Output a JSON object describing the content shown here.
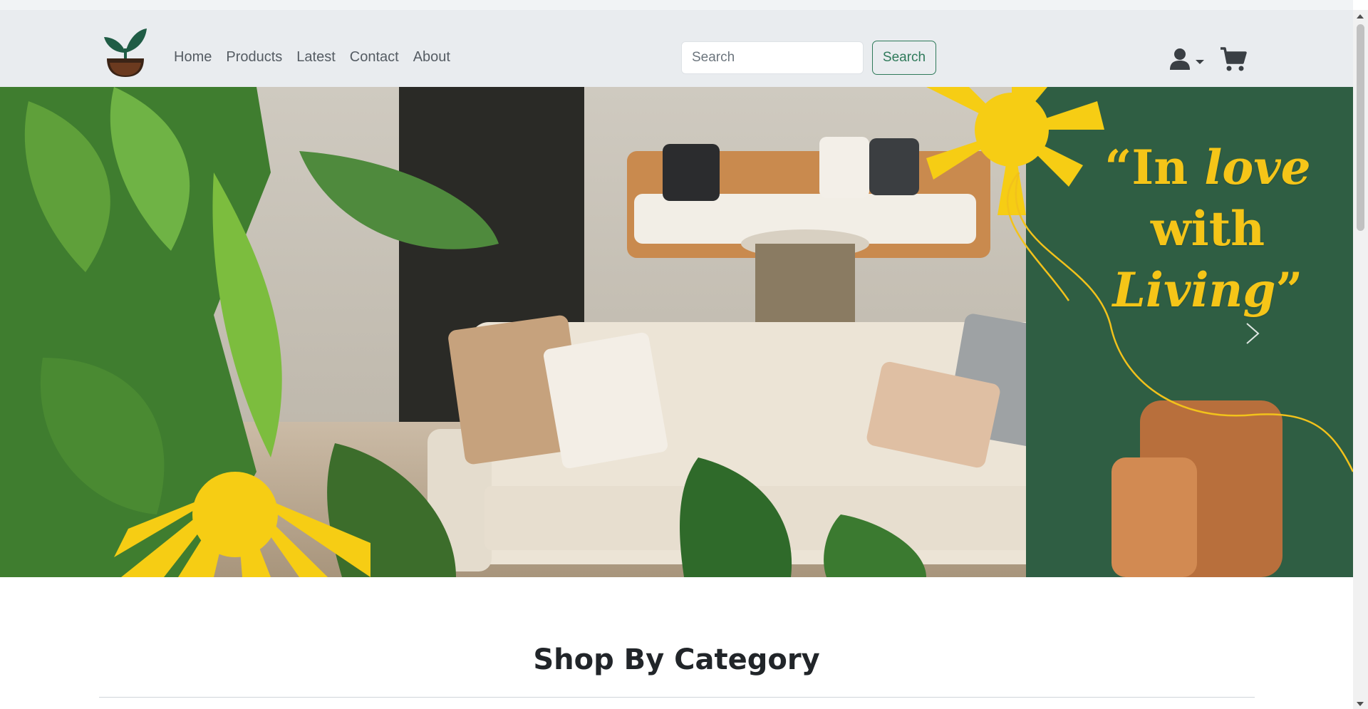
{
  "navbar": {
    "links": [
      {
        "label": "Home"
      },
      {
        "label": "Products"
      },
      {
        "label": "Latest"
      },
      {
        "label": "Contact"
      },
      {
        "label": "About"
      }
    ],
    "search": {
      "placeholder": "Search",
      "button_label": "Search"
    },
    "icons": {
      "logo": "plant-pot-logo",
      "user": "user-icon",
      "dropdown": "caret-down-icon",
      "cart": "cart-icon"
    }
  },
  "hero": {
    "quote_open": "“In ",
    "quote_love": "love",
    "quote_with": "with",
    "quote_living": "Living",
    "quote_close": "”",
    "next_icon": "chevron-right-icon"
  },
  "section": {
    "title": "Shop By Category"
  },
  "colors": {
    "navbar_bg": "#e9ecef",
    "brand_green": "#2f7a5a",
    "accent_yellow": "#f5c518",
    "logo_leaf": "#1f5c45",
    "logo_pot": "#6b3a1f"
  }
}
